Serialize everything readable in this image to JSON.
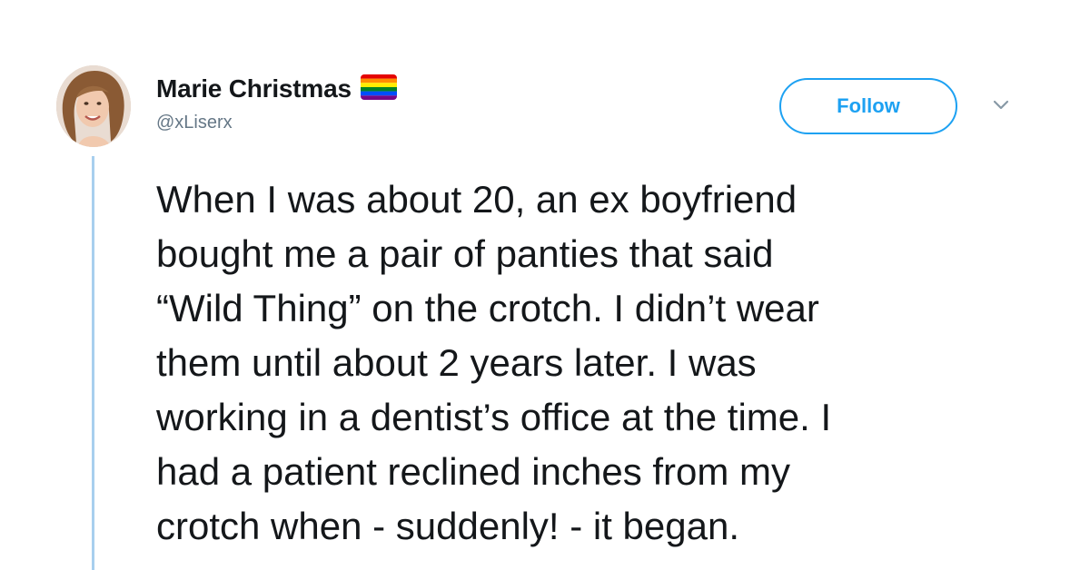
{
  "author": {
    "display_name": "Marie Christmas",
    "handle": "@xLiserx",
    "badge_icon": "rainbow-flag-icon",
    "avatar_icon": "profile-photo"
  },
  "actions": {
    "follow_label": "Follow",
    "menu_icon": "chevron-down-icon"
  },
  "tweet": {
    "lines": [
      "When I was about 20, an ex boyfriend",
      "bought me a pair of panties that said",
      "“Wild Thing” on the crotch. I didn’t wear",
      "them until about 2 years later. I was",
      "working in a dentist’s office at the time. I",
      "had a patient reclined inches from my",
      "crotch when - suddenly! - it began."
    ]
  },
  "colors": {
    "accent": "#1da1f2",
    "thread_line": "#a8cfee",
    "text": "#14171a",
    "muted": "#657786"
  }
}
